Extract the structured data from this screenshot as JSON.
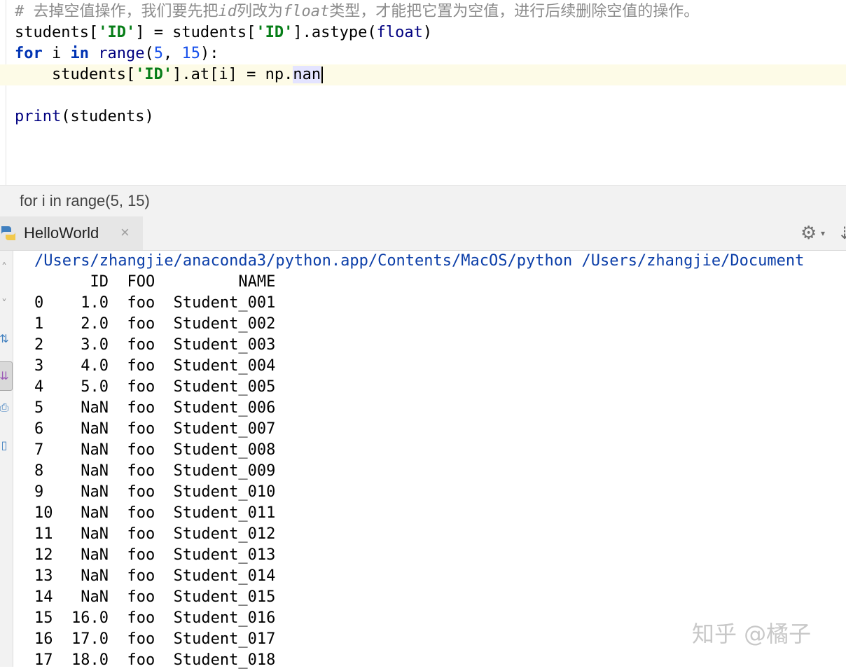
{
  "editor": {
    "comment_prefix": "# 去掉空值操作，我们要先把",
    "comment_id": "id",
    "comment_mid": "列改为",
    "comment_float": "float",
    "comment_suffix": "类型，才能把它置为空值，进行后续删除空值的操作。",
    "line2_a": "students[",
    "line2_key1": "'ID'",
    "line2_b": "] = students[",
    "line2_key2": "'ID'",
    "line2_c": "].astype(",
    "line2_float": "float",
    "line2_d": ")",
    "line3_for": "for",
    "line3_i": " i ",
    "line3_in": "in",
    "line3_sp": " ",
    "line3_range": "range",
    "line3_open": "(",
    "line3_5": "5",
    "line3_comma": ", ",
    "line3_15": "15",
    "line3_close": "):",
    "line4_a": "    students[",
    "line4_key": "'ID'",
    "line4_b": "].at[i] = np.",
    "line4_nan": "nan",
    "line6_print": "print",
    "line6_rest": "(students)"
  },
  "breadcrumb": {
    "text": "for i in range(5, 15)"
  },
  "run_panel": {
    "tab_label": "HelloWorld",
    "tab_close": "×",
    "gear_glyph": "⚙",
    "gear_caret": "▾",
    "hide_glyph": "⇣"
  },
  "console": {
    "command": "/Users/zhangjie/anaconda3/python.app/Contents/MacOS/python /Users/zhangjie/Document",
    "header": "      ID  FOO         NAME",
    "rows": [
      "0    1.0  foo  Student_001",
      "1    2.0  foo  Student_002",
      "2    3.0  foo  Student_003",
      "3    4.0  foo  Student_004",
      "4    5.0  foo  Student_005",
      "5    NaN  foo  Student_006",
      "6    NaN  foo  Student_007",
      "7    NaN  foo  Student_008",
      "8    NaN  foo  Student_009",
      "9    NaN  foo  Student_010",
      "10   NaN  foo  Student_011",
      "11   NaN  foo  Student_012",
      "12   NaN  foo  Student_013",
      "13   NaN  foo  Student_014",
      "14   NaN  foo  Student_015",
      "15  16.0  foo  Student_016",
      "16  17.0  foo  Student_017",
      "17  18.0  foo  Student_018"
    ]
  },
  "watermark": "知乎 @橘子",
  "colors": {
    "keyword": "#0033b3",
    "string": "#067d17",
    "number": "#1750eb",
    "comment": "#8c8c8c",
    "console_cmd": "#0b3ea8"
  }
}
